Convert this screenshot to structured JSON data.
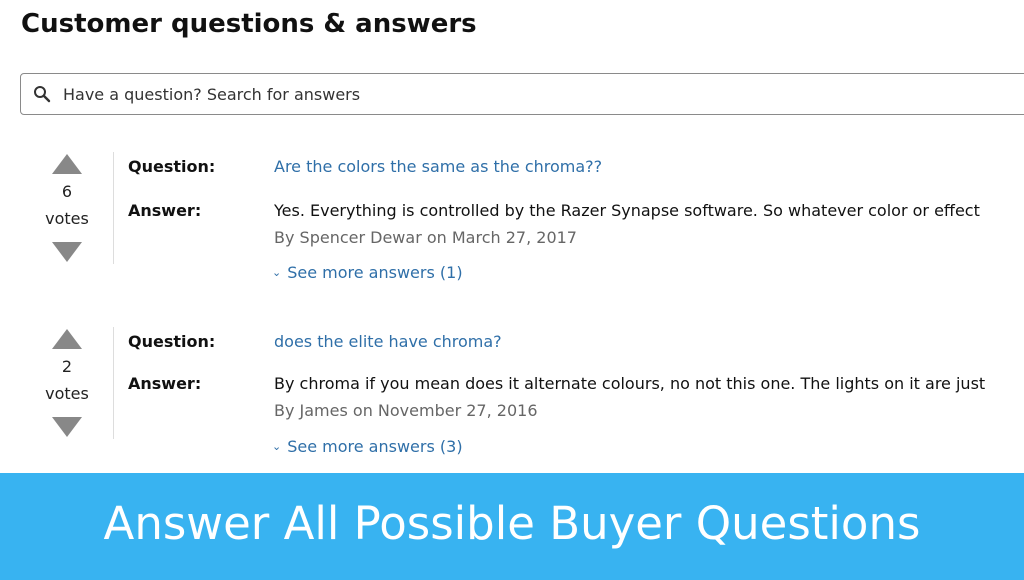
{
  "header": {
    "title": "Customer questions & answers"
  },
  "search": {
    "placeholder": "Have a question? Search for answers",
    "icon": "search-icon"
  },
  "labels": {
    "question": "Question:",
    "answer": "Answer:",
    "votes": "votes"
  },
  "qa_items": [
    {
      "votes": "6",
      "question": "Are the colors the same as the chroma??",
      "answer": "Yes. Everything is controlled by the Razer Synapse software. So whatever color or effect",
      "meta": "By Spencer Dewar on March 27, 2017",
      "see_more": "See more answers (1)"
    },
    {
      "votes": "2",
      "question": "does the elite have chroma?",
      "answer": "By chroma if you mean does it alternate colours, no not this one. The lights on it are just",
      "meta": "By James on November 27, 2016",
      "see_more": "See more answers (3)"
    }
  ],
  "banner": {
    "text": "Answer All Possible Buyer Questions",
    "color": "#38b3f1"
  },
  "colors": {
    "link": "#2f6fa8",
    "vote_arrow": "#888888"
  }
}
